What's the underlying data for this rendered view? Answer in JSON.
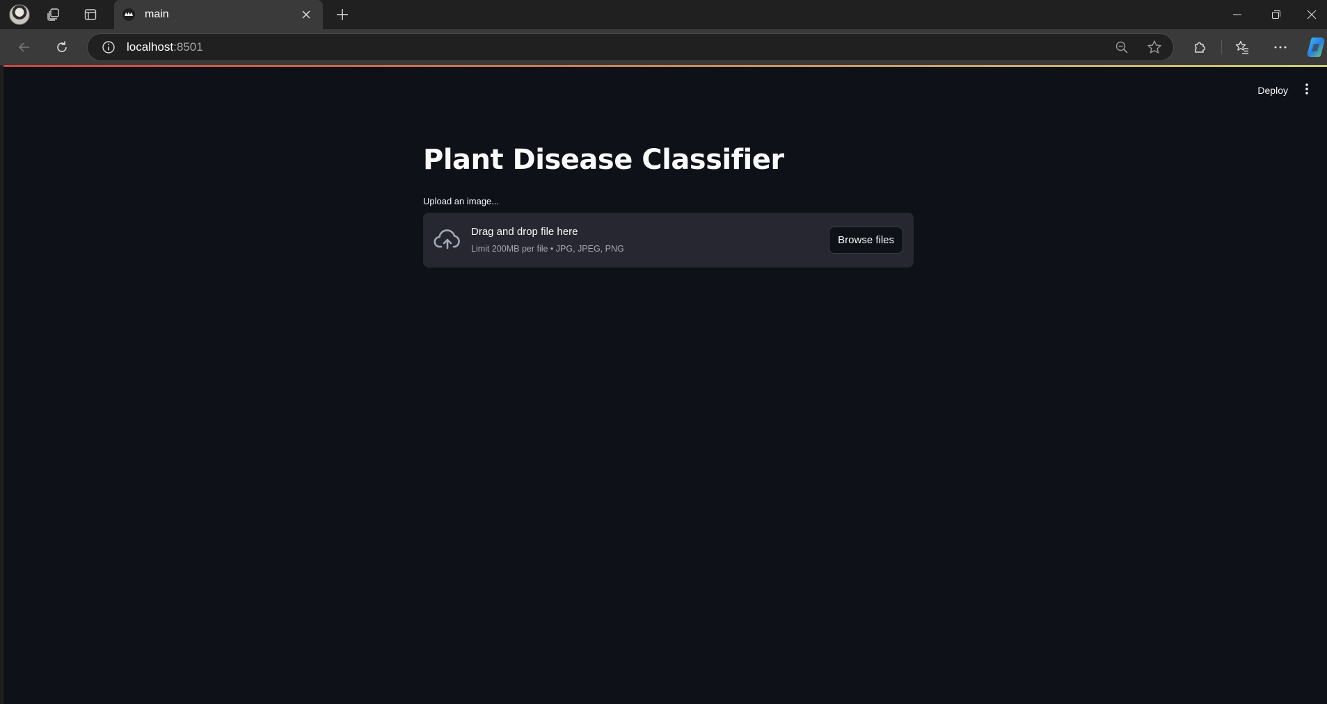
{
  "browser": {
    "tab": {
      "title": "main"
    },
    "address": {
      "host": "localhost",
      "port": ":8501"
    },
    "icons": {
      "profile": "profile-avatar",
      "workspaces": "workspaces-icon",
      "tab_actions": "tab-actions-icon",
      "new_tab": "plus-icon",
      "minimize": "minimize-icon",
      "restore": "restore-icon",
      "close": "close-icon",
      "back": "back-arrow-icon",
      "refresh": "refresh-icon",
      "site_info": "info-icon",
      "zoom": "zoom-out-icon",
      "favorite": "star-icon",
      "extensions": "puzzle-icon",
      "favorites": "favorites-icon",
      "more": "ellipsis-icon",
      "copilot": "copilot-icon"
    }
  },
  "app": {
    "header": {
      "deploy_label": "Deploy",
      "menu_icon": "vertical-dots-icon"
    },
    "decoration_colors": [
      "#ff4b4b",
      "#fffd80"
    ],
    "title": "Plant Disease Classifier",
    "uploader": {
      "label": "Upload an image...",
      "drop_text": "Drag and drop file here",
      "limit_text": "Limit 200MB per file • JPG, JPEG, PNG",
      "browse_label": "Browse files",
      "icon": "cloud-upload-icon"
    },
    "colors": {
      "background": "#0e1117",
      "dropzone": "#262730",
      "text": "#fafafa",
      "muted_text": "#a3a8b8"
    }
  }
}
